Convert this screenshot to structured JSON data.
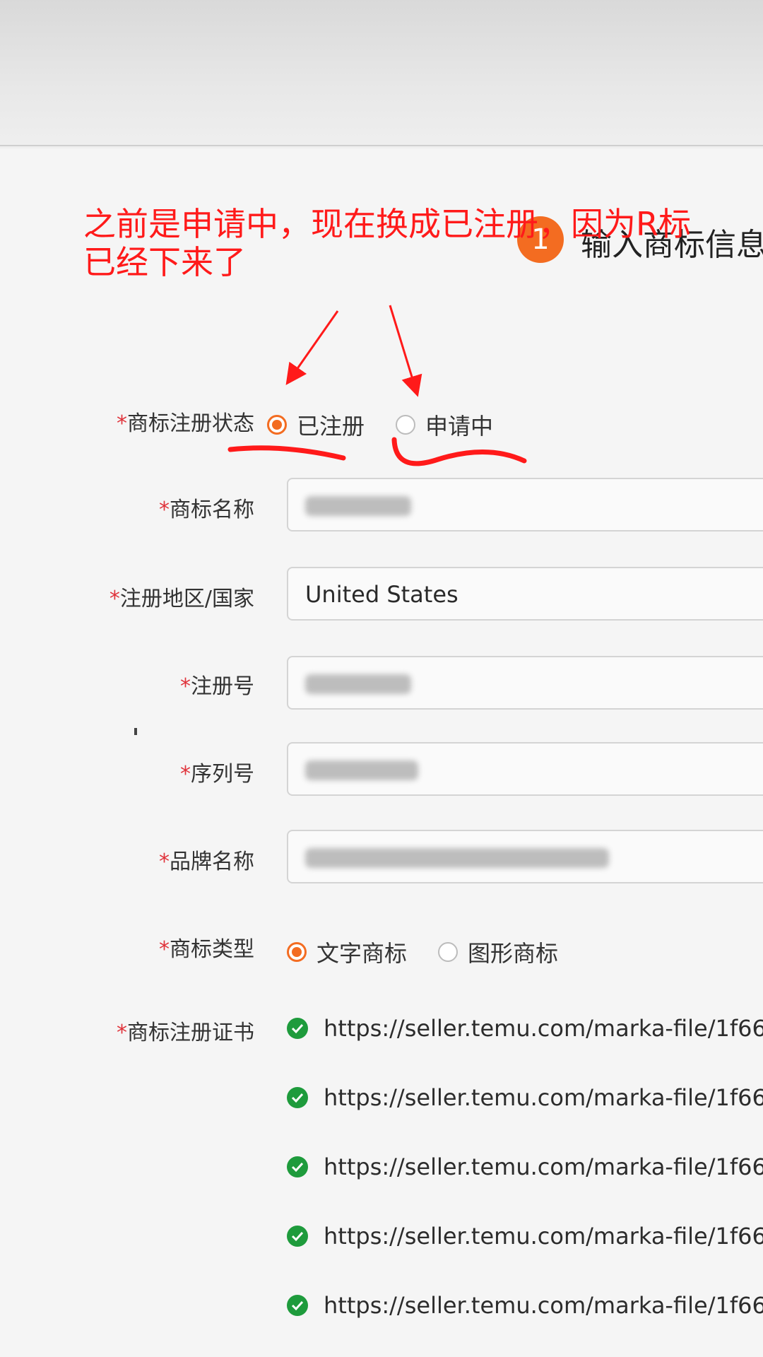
{
  "annotation": {
    "note_line1": "之前是申请中，现在换成已注册，因为R标",
    "note_line2": "已经下来了",
    "color": "#ff1a1a"
  },
  "step": {
    "number": "1",
    "title": "输入商标信息"
  },
  "form": {
    "required_mark": "*",
    "status": {
      "label": "商标注册状态",
      "options": [
        {
          "label": "已注册",
          "checked": true
        },
        {
          "label": "申请中",
          "checked": false
        }
      ]
    },
    "trademark_name": {
      "label": "商标名称",
      "value": "[blurred]"
    },
    "region": {
      "label": "注册地区/国家",
      "value": "United States"
    },
    "registration_number": {
      "label": "注册号",
      "value": "[blurred]"
    },
    "serial_number": {
      "label": "序列号",
      "value": "[blurred]"
    },
    "brand_name": {
      "label": "品牌名称",
      "value": "[blurred]"
    },
    "trademark_type": {
      "label": "商标类型",
      "options": [
        {
          "label": "文字商标",
          "checked": true
        },
        {
          "label": "图形商标",
          "checked": false
        }
      ]
    },
    "certificate": {
      "label": "商标注册证书",
      "files": [
        "https://seller.temu.com/marka-file/1f66",
        "https://seller.temu.com/marka-file/1f66",
        "https://seller.temu.com/marka-file/1f66",
        "https://seller.temu.com/marka-file/1f66",
        "https://seller.temu.com/marka-file/1f66"
      ]
    }
  },
  "colors": {
    "accent": "#f36c21",
    "success": "#1e9b3c",
    "required": "#e0333b"
  }
}
